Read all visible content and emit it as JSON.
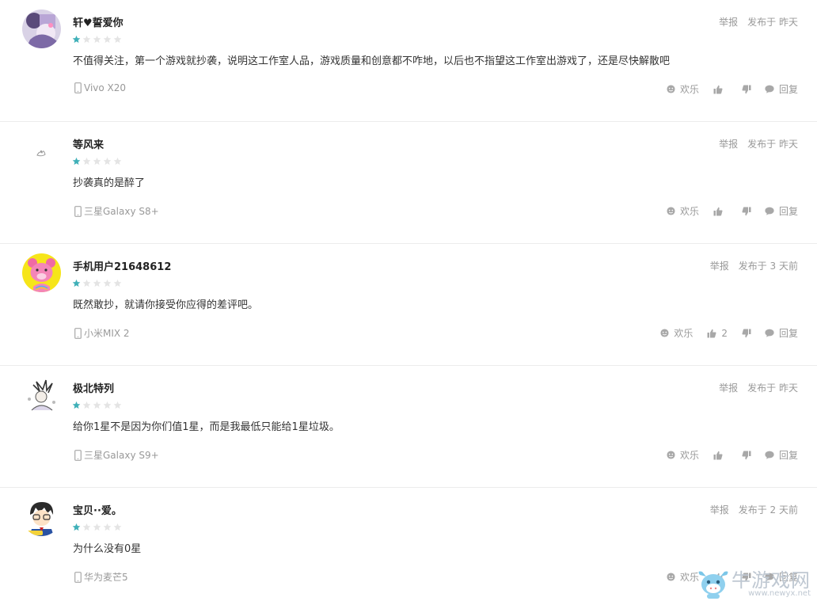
{
  "labels": {
    "report": "举报",
    "posted_prefix": "发布于",
    "fun": "欢乐",
    "reply": "回复"
  },
  "rating_color": "#3fb0b8",
  "reviews": [
    {
      "user": "轩♥誓爱你",
      "rating": 1,
      "max_rating": 5,
      "time": "昨天",
      "content": "不值得关注，第一个游戏就抄袭，说明这工作室人品，游戏质量和创意都不咋地，以后也不指望这工作室出游戏了，还是尽快解散吧",
      "device": "Vivo X20",
      "likes": "",
      "avatar": "anime-girl-avatar"
    },
    {
      "user": "等风来",
      "rating": 1,
      "max_rating": 5,
      "time": "昨天",
      "content": "抄袭真的是醉了",
      "device": "三星Galaxy S8+",
      "likes": "",
      "avatar": "small-sketch-avatar"
    },
    {
      "user": "手机用户21648612",
      "rating": 1,
      "max_rating": 5,
      "time": "3 天前",
      "content": "既然敢抄，就请你接受你应得的差评吧。",
      "device": "小米MIX 2",
      "likes": "2",
      "avatar": "pink-bear-avatar"
    },
    {
      "user": "极北特列",
      "rating": 1,
      "max_rating": 5,
      "time": "昨天",
      "content": "给你1星不是因为你们值1星，而是我最低只能给1星垃圾。",
      "device": "三星Galaxy S9+",
      "likes": "",
      "avatar": "sketch-character-avatar"
    },
    {
      "user": "宝贝··爱。",
      "rating": 1,
      "max_rating": 5,
      "time": "2 天前",
      "content": "为什么没有0星",
      "device": "华为麦芒5",
      "likes": "",
      "avatar": "detective-avatar"
    }
  ],
  "watermark": {
    "brand": "牛游戏网",
    "url": "www.newyx.net"
  }
}
